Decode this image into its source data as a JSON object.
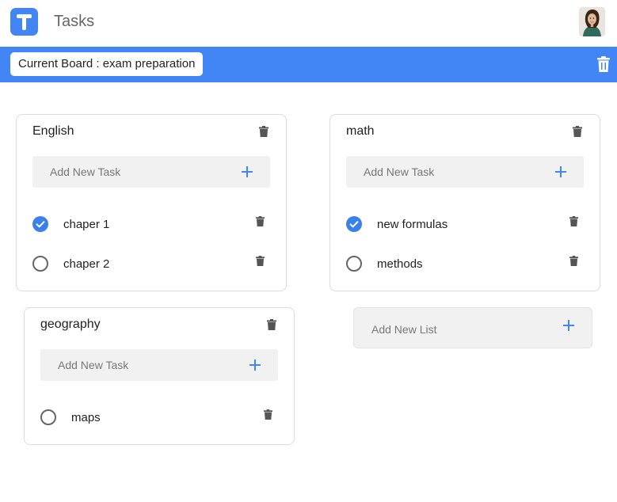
{
  "app": {
    "title": "Tasks",
    "accent": "#4285f4"
  },
  "board": {
    "label": "Current Board : exam preparation"
  },
  "lists": [
    {
      "title": "English",
      "add_task_label": "Add New Task",
      "tasks": [
        {
          "label": "chaper 1",
          "done": true
        },
        {
          "label": "chaper 2",
          "done": false
        }
      ]
    },
    {
      "title": "math",
      "add_task_label": "Add New Task",
      "tasks": [
        {
          "label": "new formulas",
          "done": true
        },
        {
          "label": "methods",
          "done": false
        }
      ]
    },
    {
      "title": "geography",
      "add_task_label": "Add New Task",
      "tasks": [
        {
          "label": "maps",
          "done": false
        }
      ]
    }
  ],
  "add_list": {
    "label": "Add New List"
  },
  "icons": {
    "logo": "t-logo-icon",
    "avatar": "user-avatar",
    "trash": "trash-icon",
    "plus": "plus-icon",
    "checked": "check-circle-icon",
    "unchecked": "empty-circle-icon"
  }
}
